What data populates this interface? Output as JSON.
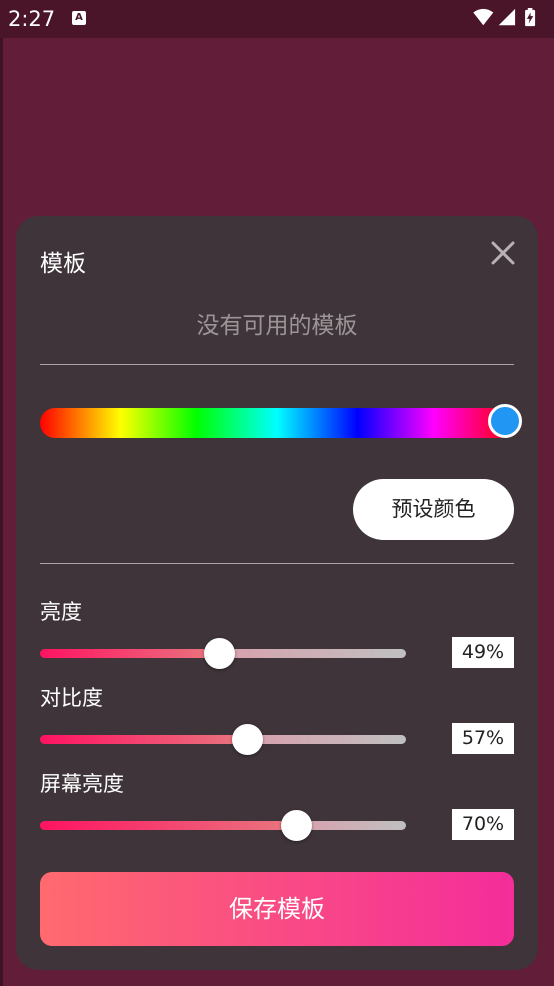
{
  "status_bar": {
    "time": "2:27",
    "app_icon_letter": "A",
    "icons": [
      "wifi-icon",
      "signal-icon",
      "battery-charging-icon"
    ]
  },
  "dialog": {
    "title": "模板",
    "empty_message": "没有可用的模板",
    "preset_button": "预设颜色",
    "hue_selected_color": "#2196f3",
    "hue_position": 0.93,
    "sliders": [
      {
        "label": "亮度",
        "value": 49,
        "display": "49%"
      },
      {
        "label": "对比度",
        "value": 57,
        "display": "57%"
      },
      {
        "label": "屏幕亮度",
        "value": 70,
        "display": "70%"
      }
    ],
    "save_button": "保存模板"
  },
  "colors": {
    "background": "#621d39",
    "dialog_bg": "#3e3439",
    "accent_start": "#ff6a6e",
    "accent_end": "#f42d9a",
    "slider_start": "#ff1362"
  }
}
